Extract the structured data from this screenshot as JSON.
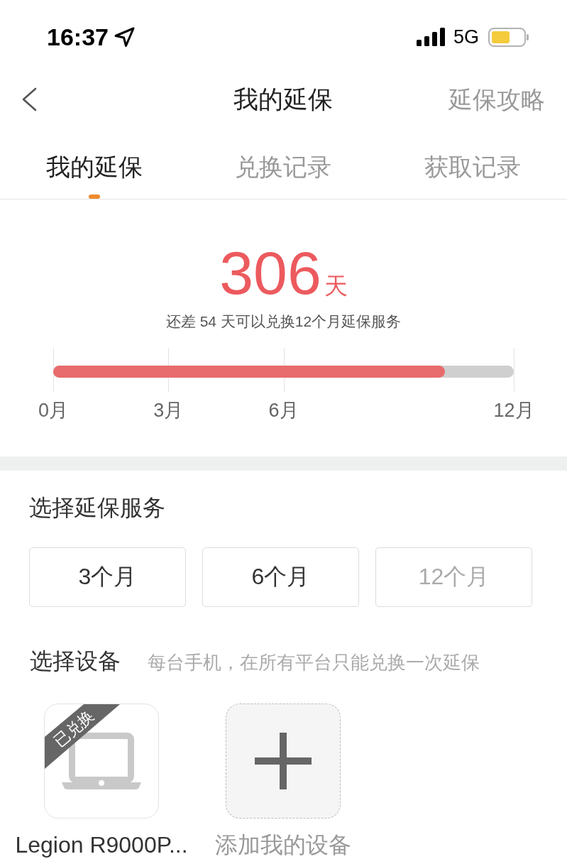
{
  "status_bar": {
    "time": "16:37",
    "network": "5G"
  },
  "nav": {
    "title": "我的延保",
    "action": "延保攻略"
  },
  "tabs": [
    {
      "label": "我的延保",
      "selected": true
    },
    {
      "label": "兑换记录",
      "selected": false
    },
    {
      "label": "获取记录",
      "selected": false
    }
  ],
  "summary": {
    "days": "306",
    "unit": "天",
    "note": "还差 54 天可以兑换12个月延保服务"
  },
  "progress": {
    "level": 0.85,
    "ticks": [
      "0月",
      "3月",
      "6月",
      "12月"
    ]
  },
  "service_section": {
    "title": "选择延保服务",
    "options": [
      {
        "label": "3个月",
        "selected": false,
        "disabled": false
      },
      {
        "label": "6个月",
        "selected": false,
        "disabled": false
      },
      {
        "label": "12个月",
        "selected": false,
        "disabled": true
      }
    ]
  },
  "device_section": {
    "title": "选择设备",
    "hint": "每台手机，在所有平台只能兑换一次延保",
    "devices": [
      {
        "kind": "device",
        "name": "Legion R9000P...",
        "redeemed": true,
        "badge": "已兑换"
      },
      {
        "kind": "add",
        "label": "添加我的设备"
      }
    ]
  }
}
